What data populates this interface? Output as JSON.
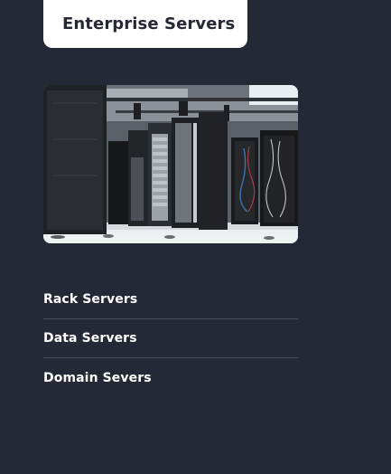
{
  "header": {
    "title": "Enterprise Servers"
  },
  "hero_image": {
    "icon": "server-room-photo"
  },
  "menu": {
    "items": [
      {
        "label": "Rack Servers"
      },
      {
        "label": "Data Servers"
      },
      {
        "label": "Domain Severs"
      }
    ]
  },
  "colors": {
    "background": "#252835",
    "card": "#ffffff",
    "divider": "#4a4d5a",
    "text_light": "#ffffff",
    "text_dark": "#252835"
  }
}
